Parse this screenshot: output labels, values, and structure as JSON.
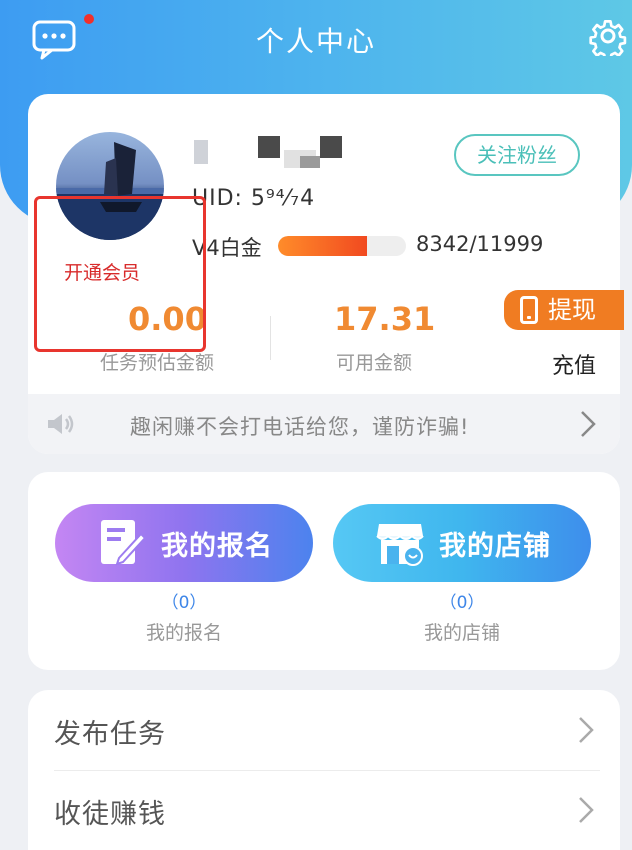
{
  "header": {
    "title": "个人中心",
    "message_icon": "chat-bubble-icon",
    "settings_icon": "gear-icon",
    "colors": {
      "gradient_start": "#3d9cf2",
      "gradient_end": "#5ec8e6",
      "unread_dot": "#f0302b"
    }
  },
  "profile": {
    "nickname_partial": "ᵥ",
    "uid_label": "UID: 5",
    "uid_visible": "UID: 5⁹⁴⁄₇4",
    "follow_label": "关注粉丝",
    "level_label": "V4白金",
    "level_current": 8342,
    "level_max": 11999,
    "level_progress_text": "8342/11999",
    "membership_label": "开通会员",
    "avatar_icon": "sailboat-avatar"
  },
  "stats": {
    "estimated": {
      "value": "0.00",
      "label": "任务预估金额"
    },
    "available": {
      "value": "17.31",
      "label": "可用金额"
    },
    "withdraw_label": "提现",
    "recharge_label": "充值"
  },
  "notice": {
    "text": "趣闲赚不会打电话给您，谨防诈骗!"
  },
  "actions": {
    "signup": {
      "button_label": "我的报名",
      "count": "（0）",
      "label": "我的报名",
      "icon": "form-edit-icon"
    },
    "shop": {
      "button_label": "我的店铺",
      "count": "（0）",
      "label": "我的店铺",
      "icon": "storefront-icon"
    }
  },
  "menu": {
    "items": [
      {
        "label": "发布任务"
      },
      {
        "label": "收徒赚钱"
      }
    ]
  }
}
